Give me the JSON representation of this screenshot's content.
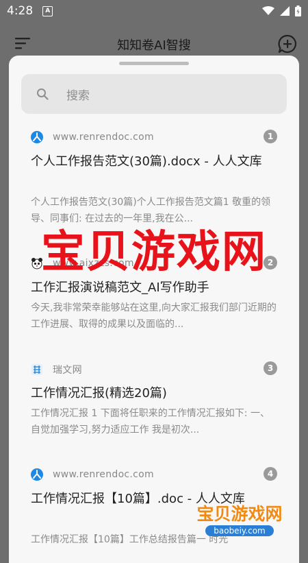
{
  "status_bar": {
    "time": "4:28",
    "notification_badge": "A"
  },
  "app_bar": {
    "title": "知知卷AI智搜"
  },
  "search": {
    "placeholder": "搜索"
  },
  "results": [
    {
      "site": "www.renrendoc.com",
      "favicon": "renren-icon",
      "number": "1",
      "title": "个人工作报告范文(30篇).docx - 人人文库",
      "description": "个人工作报告范文(30篇)个人工作报告范文篇1 敬重的领导、同事们: 在过去的一年里,我在公..."
    },
    {
      "site": "www.aixzzs.com",
      "favicon": "panda-icon",
      "number": "2",
      "title": "工作汇报演说稿范文_AI写作助手",
      "description": "今天,我非常荣幸能够站在这里,向大家汇报我们部门近期的工作进展、取得的成果以及面临的..."
    },
    {
      "site": "瑞文网",
      "favicon": "ruiwen-icon",
      "number": "3",
      "title": "工作情况汇报(精选20篇)",
      "description": "工作情况汇报 1 下面将任职来的工作情况汇报如下: 一、自觉加强学习,努力适应工作 我是初次..."
    },
    {
      "site": "www.renrendoc.com",
      "favicon": "renren-icon",
      "number": "4",
      "title": "工作情况汇报【10篇】.doc - 人人文库",
      "description": "工作情况汇报【10篇】工作总结报告篇一 时光"
    }
  ],
  "watermark": {
    "big": "宝贝游戏网",
    "small": "宝贝游戏网",
    "url": "baobeiy.com"
  },
  "colors": {
    "accent_blue": "#1e88e5",
    "watermark_red": "#e8131a"
  }
}
